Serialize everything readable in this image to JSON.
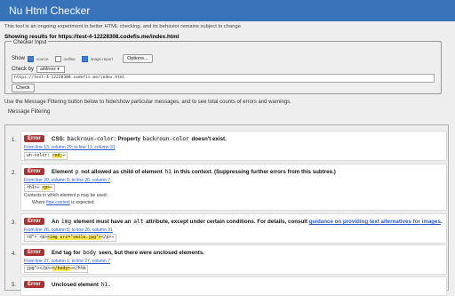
{
  "app": {
    "title": "Nu Html Checker",
    "notice": "This tool is an ongoing experiment in better HTML checking, and its behavior remains subject to change",
    "showing": "Showing results for https://test-4-12228308.codefis.me/index.html"
  },
  "checker": {
    "legend": "Checker Input",
    "show_label": "Show",
    "options": [
      {
        "label": "source",
        "checked": true
      },
      {
        "label": "outline",
        "checked": false
      },
      {
        "label": "image report",
        "checked": true
      }
    ],
    "options_button": "Options...",
    "check_by_label": "Check by",
    "check_by_value": "address",
    "url_value": "https://test-4-12228308.codefis.me/index.html",
    "check_button": "Check"
  },
  "filtering": {
    "info": "Use the Message Filtering button below to hide/show particular messages, and to see total counts of errors and warnings.",
    "button": "Message Filtering"
  },
  "messages": [
    {
      "num": "1.",
      "type": "Error",
      "text": "CSS: ",
      "code1": "backroun-color",
      "text2": ": Property ",
      "code2": "backroun-color",
      "text3": " doesn't exist.",
      "loc": "From line 13, column 29; to line 13, column 31",
      "extract_pre": "un-color: ",
      "extract_hl": "red;",
      "extract_post": "↩"
    },
    {
      "num": "2.",
      "type": "Error",
      "text": "Element ",
      "code1": "p",
      "text2": " not allowed as child of element ",
      "code2": "h1",
      "text3": " in this context. (Suppressing further errors from this subtree.)",
      "loc": "From line 20, column 5; to line 20, column 7",
      "extract_pre": "<h1>↩    ",
      "extract_hl": "<p>",
      "extract_post": "↩",
      "detail1": "Contexts in which element p may be used:",
      "detail2_pre": "Where ",
      "detail2_link": "flow content",
      "detail2_post": " is expected."
    },
    {
      "num": "3.",
      "type": "Error",
      "text": "An ",
      "code1": "img",
      "text2": " element must have an ",
      "code2": "alt",
      "text3": " attribute, except under certain conditions. For details, consult ",
      "link": "guidance on providing text alternatives for images",
      "text4": ".",
      "loc": "From line 26, column 5; to line 26, column 31",
      "extract_pre": "rd\">    <p>",
      "extract_hl": "<img src=\"smile.jpg\">",
      "extract_post": "</p>↩"
    },
    {
      "num": "4.",
      "type": "Error",
      "text": "End tag for ",
      "code1": "body",
      "text2": " seen, but there were unclosed elements.",
      "code2": "",
      "text3": "",
      "loc": "From line 27, column 1; to line 27, column 7",
      "extract_pre": "jpg\"></p>↩",
      "extract_hl": "</body>",
      "extract_post": "↩</htm"
    },
    {
      "num": "5.",
      "type": "Error",
      "text": "Unclosed element ",
      "code1": "h1",
      "text2": ".",
      "code2": "",
      "text3": ""
    }
  ]
}
